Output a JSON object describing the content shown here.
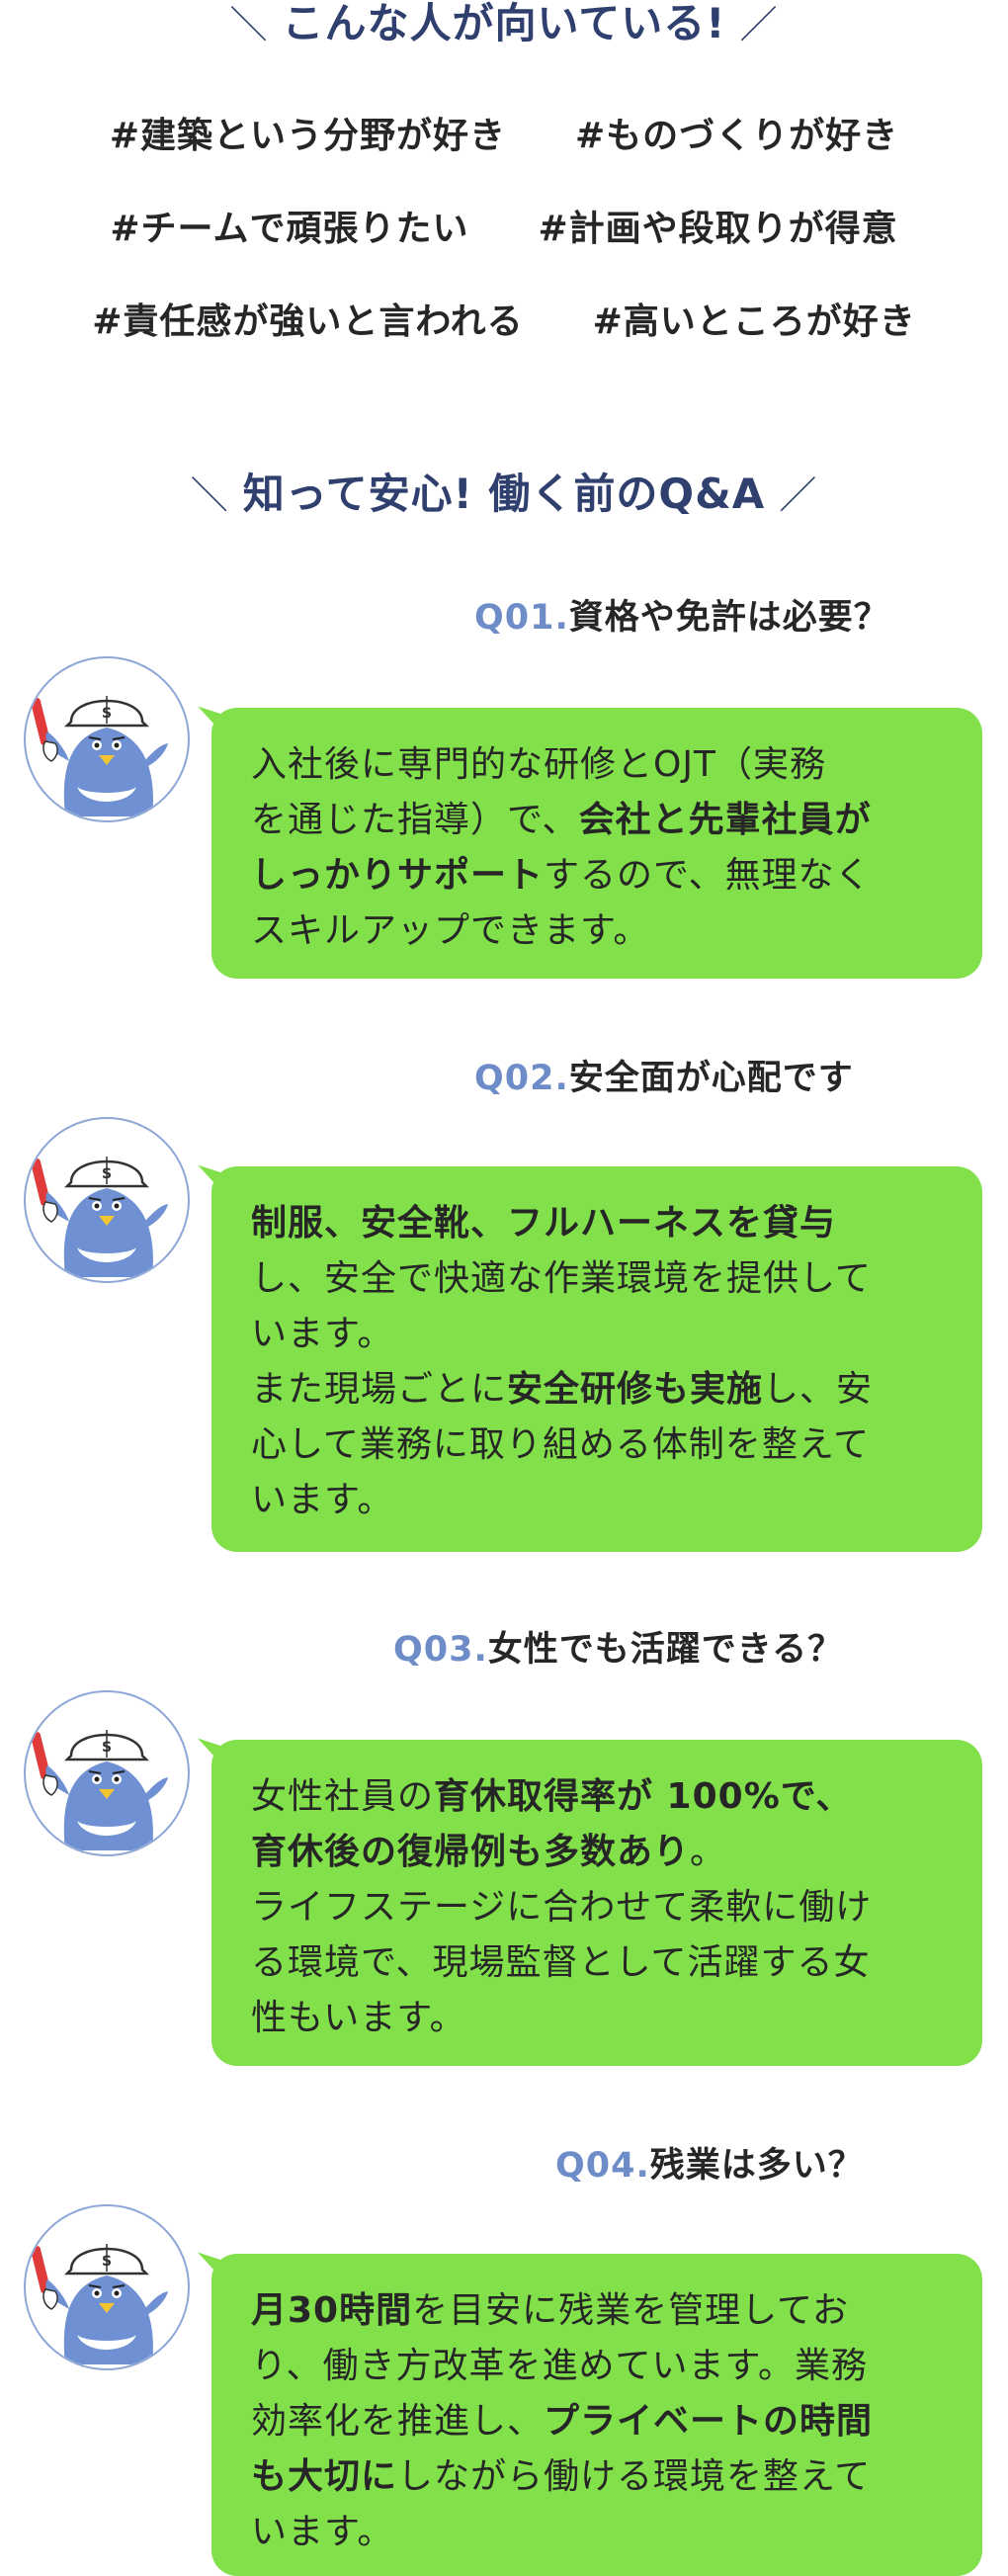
{
  "section1": {
    "title": "こんな人が向いている!",
    "slash_left": "＼",
    "slash_right": "／",
    "tags": [
      [
        "#建築という分野が好き",
        "#ものづくりが好き"
      ],
      [
        "#チームで頑張りたい",
        "#計画や段取りが得意"
      ],
      [
        "#責任感が強いと言われる",
        "#高いところが好き"
      ]
    ]
  },
  "section2": {
    "title": "知って安心! 働く前のQ&A",
    "slash_left": "＼",
    "slash_right": "／"
  },
  "qa": [
    {
      "num": "Q01.",
      "question": "資格や免許は必要？",
      "lines": [
        [
          {
            "t": "入社後に専門的な研修とOJT（実務",
            "b": false
          }
        ],
        [
          {
            "t": "を通じた指導）で、",
            "b": false
          },
          {
            "t": "会社と先輩社員が",
            "b": true
          }
        ],
        [
          {
            "t": "しっかりサポート",
            "b": true
          },
          {
            "t": "するので、無理なく",
            "b": false
          }
        ],
        [
          {
            "t": "スキルアップできます。",
            "b": false
          }
        ]
      ]
    },
    {
      "num": "Q02.",
      "question": "安全面が心配です",
      "lines": [
        [
          {
            "t": "制服、安全靴、フルハーネスを貸与",
            "b": true
          }
        ],
        [
          {
            "t": "し、安全で快適な作業環境を提供して",
            "b": false
          }
        ],
        [
          {
            "t": "います。",
            "b": false
          }
        ],
        [
          {
            "t": "また現場ごとに",
            "b": false
          },
          {
            "t": "安全研修も実施",
            "b": true
          },
          {
            "t": "し、安",
            "b": false
          }
        ],
        [
          {
            "t": "心して業務に取り組める体制を整えて",
            "b": false
          }
        ],
        [
          {
            "t": "います。",
            "b": false
          }
        ]
      ]
    },
    {
      "num": "Q03.",
      "question": "女性でも活躍できる？",
      "lines": [
        [
          {
            "t": "女性社員の",
            "b": false
          },
          {
            "t": "育休取得率が 100%で、",
            "b": true
          }
        ],
        [
          {
            "t": "育休後の復帰例も多数あり",
            "b": true
          },
          {
            "t": "。",
            "b": false
          }
        ],
        [
          {
            "t": "ライフステージに合わせて柔軟に働け",
            "b": false
          }
        ],
        [
          {
            "t": "る環境で、現場監督として活躍する女",
            "b": false
          }
        ],
        [
          {
            "t": "性もいます。",
            "b": false
          }
        ]
      ]
    },
    {
      "num": "Q04.",
      "question": "残業は多い？",
      "lines": [
        [
          {
            "t": "月30時間",
            "b": true
          },
          {
            "t": "を目安に残業を管理してお",
            "b": false
          }
        ],
        [
          {
            "t": "り、働き方改革を進めています。業務",
            "b": false
          }
        ],
        [
          {
            "t": "効率化を推進し、",
            "b": false
          },
          {
            "t": "プライベートの時間",
            "b": true
          }
        ],
        [
          {
            "t": "も大切に",
            "b": true
          },
          {
            "t": "しながら働ける環境を整えて",
            "b": false
          }
        ],
        [
          {
            "t": "います。",
            "b": false
          }
        ]
      ]
    }
  ],
  "mascot": {
    "helmet_letter": "S",
    "colors": {
      "body": "#6f90d2",
      "helmet": "#ffffff",
      "beak": "#f2c531",
      "baton": "#e03a3a",
      "bubble": "#82e04a",
      "qnum": "#6e8cc8",
      "heading": "#2f3f6e"
    }
  }
}
